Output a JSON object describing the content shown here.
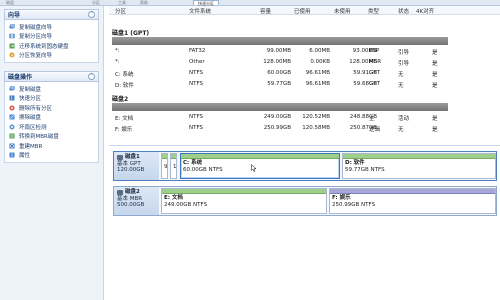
{
  "top_tabs": [
    "磁盘",
    "分区",
    "工具",
    "帮助",
    "快速分区"
  ],
  "left_panel": {
    "wizard": {
      "title": "向导",
      "items": [
        {
          "label": "复制磁盘向导",
          "icon": "copy-disk-icon"
        },
        {
          "label": "复制分区向导",
          "icon": "copy-partition-icon"
        },
        {
          "label": "迁移系统到固态硬盘",
          "icon": "migrate-os-icon"
        },
        {
          "label": "分区恢复向导",
          "icon": "recover-partition-icon"
        }
      ]
    },
    "disk_ops": {
      "title": "磁盘操作",
      "items": [
        {
          "label": "复制磁盘",
          "icon": "copy-disk-icon"
        },
        {
          "label": "快速分区",
          "icon": "quick-partition-icon"
        },
        {
          "label": "删除所有分区",
          "icon": "delete-all-icon"
        },
        {
          "label": "擦除磁盘",
          "icon": "wipe-disk-icon"
        },
        {
          "label": "坏扇区检测",
          "icon": "bad-sector-icon"
        },
        {
          "label": "转换到MBR磁盘",
          "icon": "convert-mbr-icon"
        },
        {
          "label": "重建MBR",
          "icon": "rebuild-mbr-icon"
        },
        {
          "label": "属性",
          "icon": "properties-icon"
        }
      ]
    }
  },
  "table": {
    "headers": [
      "分区",
      "文件系统",
      "容量",
      "已使用",
      "未使用",
      "类型",
      "状态",
      "4K对齐"
    ],
    "groups": [
      {
        "label": "磁盘1 (GPT)",
        "rows": [
          [
            "*:",
            "FAT32",
            "99.00MB",
            "6.00MB",
            "93.00MB",
            "ESP",
            "引导",
            "是"
          ],
          [
            "*:",
            "Other",
            "128.00MB",
            "0.00KB",
            "128.00MB",
            "MSR",
            "引导",
            "是"
          ],
          [
            "C: 系统",
            "NTFS",
            "60.00GB",
            "96.61MB",
            "59.91GB",
            "GPT",
            "无",
            "是"
          ],
          [
            "D: 软件",
            "NTFS",
            "59.77GB",
            "96.61MB",
            "59.68GB",
            "GPT",
            "无",
            "是"
          ]
        ]
      },
      {
        "label": "磁盘2",
        "rows": [
          [
            "E: 文档",
            "NTFS",
            "249.00GB",
            "120.52MB",
            "248.88GB",
            "主",
            "活动",
            "是"
          ],
          [
            "F: 娱乐",
            "NTFS",
            "250.99GB",
            "120.58MB",
            "250.87GB",
            "逻辑",
            "无",
            "是"
          ]
        ]
      }
    ]
  },
  "disk_map": [
    {
      "name": "磁盘1",
      "type": "基本 GPT",
      "size": "120.00GB",
      "partitions": [
        {
          "label": "9",
          "small": true
        },
        {
          "label": "1",
          "small": true
        },
        {
          "name": "C: 系统",
          "info": "60.00GB NTFS",
          "selected": true
        },
        {
          "name": "D: 软件",
          "info": "59.77GB NTFS"
        }
      ]
    },
    {
      "name": "磁盘2",
      "type": "基本 MBR",
      "size": "500.00GB",
      "partitions": [
        {
          "name": "E: 文档",
          "info": "249.00GB NTFS"
        },
        {
          "name": "F: 娱乐",
          "info": "250.99GB NTFS",
          "color": "purple"
        }
      ]
    }
  ],
  "colors": {
    "used_bar": "#9fd08a",
    "logical_bar": "#a6a7d6",
    "accent": "#3b78c4"
  }
}
